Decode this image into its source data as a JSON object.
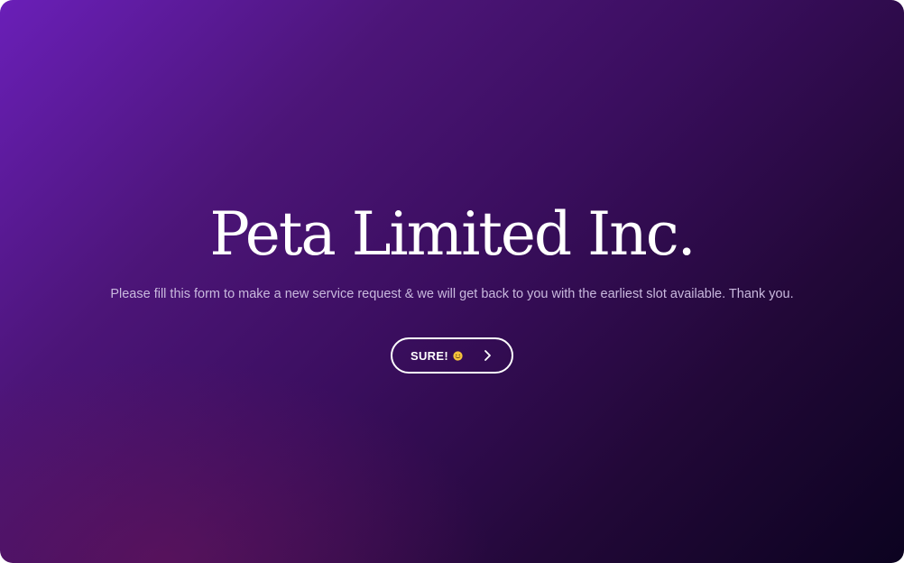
{
  "hero": {
    "title": "Peta Limited Inc.",
    "subtitle": "Please fill this form to make a new service request & we will get back to you with the earliest slot available. Thank you.",
    "cta": {
      "label": "SURE!",
      "emoji_icon": "smiley-face-icon",
      "arrow_icon": "chevron-right-icon"
    }
  },
  "colors": {
    "gradient_start": "#6a1fb8",
    "gradient_end": "#0c0320",
    "title_text": "#ffffff",
    "subtitle_text": "#c9b9de",
    "button_border": "#ffffff"
  }
}
